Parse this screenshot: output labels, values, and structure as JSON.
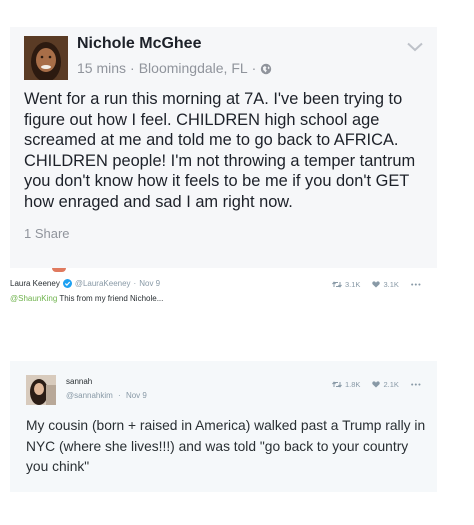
{
  "facebook_post": {
    "author": "Nichole McGhee",
    "time": "15 mins",
    "separator": "·",
    "location": "Bloomingdale, FL",
    "privacy_icon": "globe-icon",
    "body": "Went for a run this morning at 7A. I've been trying to figure out how I feel. CHILDREN high school age screamed at me and told me to go back to AFRICA. CHILDREN people! I'm not throwing a temper tantrum you don't know how it feels to be me if you don't GET how enraged and sad I am right now.",
    "shares": "1 Share",
    "menu_icon": "chevron-down-icon"
  },
  "tweet_laura": {
    "name": "Laura Keeney",
    "handle": "@LauraKeeney",
    "date": "Nov 9",
    "mention": "@ShaunKing",
    "text": " This from my friend Nichole...",
    "retweets": "3.1K",
    "likes": "3.1K"
  },
  "tweet_sannah": {
    "name": "sannah",
    "handle": "@sannahkim",
    "date": "Nov 9",
    "body": "My cousin (born + raised in America) walked past a Trump rally in NYC (where she lives!!!) and was told \"go back to your country you chink\"",
    "retweets": "1.8K",
    "likes": "2.1K"
  },
  "colors": {
    "fb_card_bg": "#f6f7f9",
    "tw_card_bg": "#f5f8fa",
    "mention_green": "#6fb34d",
    "muted": "#90949c",
    "verified_blue": "#1da1f2"
  }
}
